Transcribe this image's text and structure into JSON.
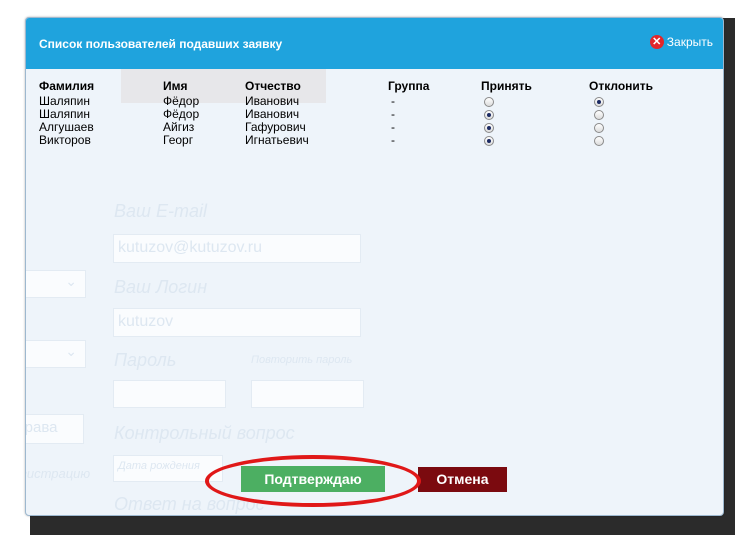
{
  "modal": {
    "title": "Список пользователей подавших заявку",
    "close_label": "Закрыть"
  },
  "table": {
    "headers": [
      "Фамилия",
      "Имя",
      "Отчество",
      "Группа",
      "Принять",
      "Отклонить"
    ],
    "rows": [
      {
        "last_name": "Шаляпин",
        "first_name": "Фёдор",
        "patronymic": "Иванович",
        "group": "-",
        "decision": "reject"
      },
      {
        "last_name": "Шаляпин",
        "first_name": "Фёдор",
        "patronymic": "Иванович",
        "group": "-",
        "decision": "accept"
      },
      {
        "last_name": "Алгушаев",
        "first_name": "Айгиз",
        "patronymic": "Гафурович",
        "group": "-",
        "decision": "accept"
      },
      {
        "last_name": "Викторов",
        "first_name": "Георг",
        "patronymic": "Игнатьевич",
        "group": "-",
        "decision": "accept"
      }
    ]
  },
  "buttons": {
    "confirm_label": "Подтверждаю",
    "cancel_label": "Отмена"
  },
  "background_form": {
    "email_label": "Ваш E-mail",
    "email_value": "kutuzov@kutuzov.ru",
    "login_label": "Ваш Логин",
    "login_value": "kutuzov",
    "password_label": "Пароль",
    "repeat_password_label": "Повторить пароль",
    "secret_question_label": "Контрольный вопрос",
    "secret_question_placeholder": "Дата рождения",
    "answer_label": "Ответ на вопрос",
    "rights_fragment": "и права",
    "registration_fragment": "регистрацию"
  },
  "colors": {
    "header": "#1fa3dd",
    "confirm": "#4caf62",
    "cancel": "#7b0a0f",
    "highlight_oval": "#e01818",
    "close_icon": "#e2262a"
  }
}
